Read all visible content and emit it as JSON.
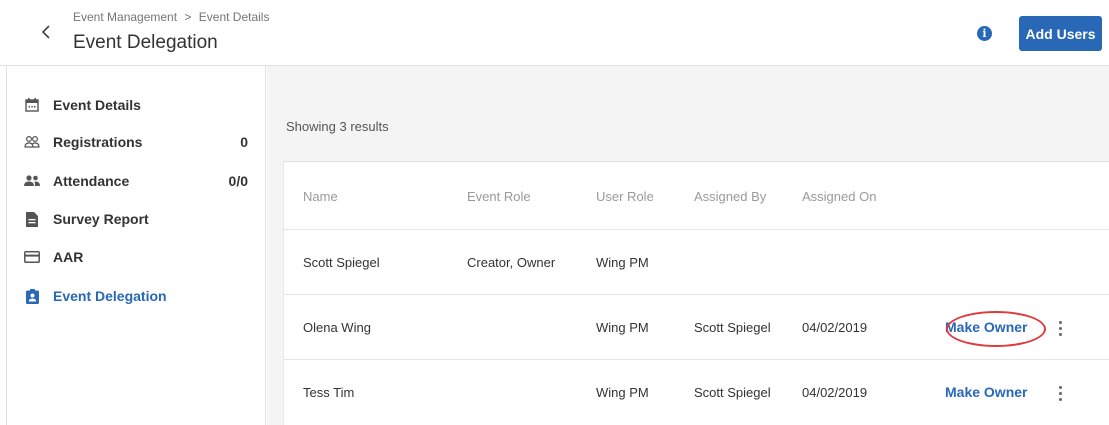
{
  "header": {
    "breadcrumb": {
      "parent": "Event Management",
      "separator": ">",
      "current": "Event Details"
    },
    "title": "Event Delegation",
    "info_icon": "info-icon",
    "add_users_label": "Add Users"
  },
  "colors": {
    "accent": "#2868b6",
    "annotation": "#e0393e"
  },
  "sidebar": {
    "items": [
      {
        "label": "Event Details",
        "count": "",
        "icon": "calendar-icon"
      },
      {
        "label": "Registrations",
        "count": "0",
        "icon": "people-outline-icon"
      },
      {
        "label": "Attendance",
        "count": "0/0",
        "icon": "people-filled-icon"
      },
      {
        "label": "Survey Report",
        "count": "",
        "icon": "document-icon"
      },
      {
        "label": "AAR",
        "count": "",
        "icon": "card-icon"
      },
      {
        "label": "Event Delegation",
        "count": "",
        "icon": "badge-icon",
        "active": true
      }
    ]
  },
  "main": {
    "results_text": "Showing 3 results",
    "table": {
      "headers": [
        "Name",
        "Event Role",
        "User Role",
        "Assigned By",
        "Assigned On"
      ],
      "rows": [
        {
          "name": "Scott Spiegel",
          "event_role": "Creator, Owner",
          "user_role": "Wing PM",
          "assigned_by": "",
          "assigned_on": "",
          "action": ""
        },
        {
          "name": "Olena Wing",
          "event_role": "",
          "user_role": "Wing PM",
          "assigned_by": "Scott Spiegel",
          "assigned_on": "04/02/2019",
          "action": "Make Owner"
        },
        {
          "name": "Tess Tim",
          "event_role": "",
          "user_role": "Wing PM",
          "assigned_by": "Scott Spiegel",
          "assigned_on": "04/02/2019",
          "action": "Make Owner"
        }
      ]
    }
  }
}
